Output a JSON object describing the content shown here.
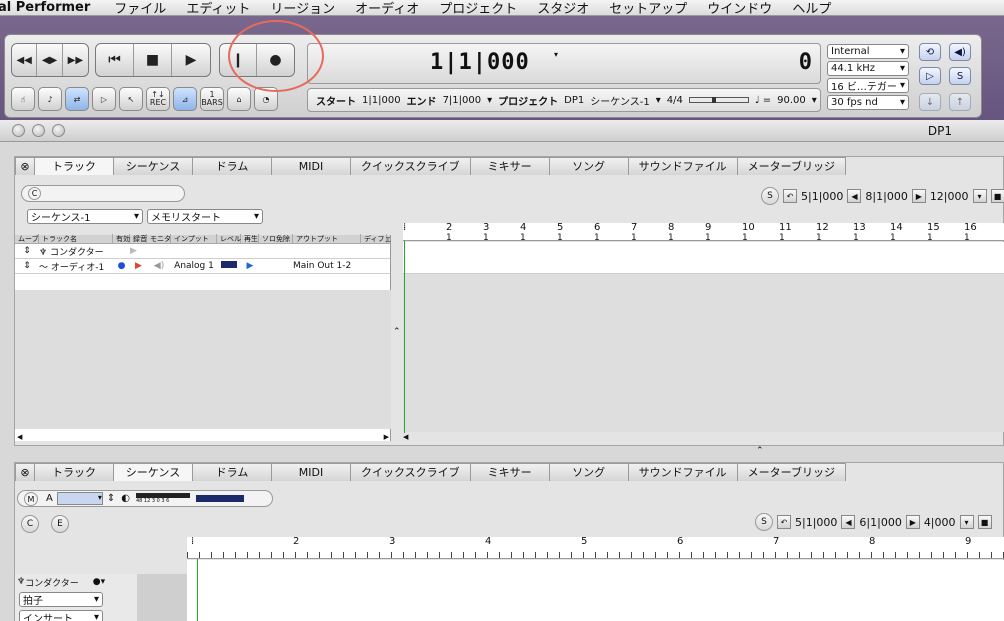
{
  "menubar": {
    "app": "al Performer",
    "items": [
      "ファイル",
      "エディット",
      "リージョン",
      "オーディオ",
      "プロジェクト",
      "スタジオ",
      "セットアップ",
      "ウインドウ",
      "ヘルプ"
    ]
  },
  "transport": {
    "counter_main": "1|1|000",
    "counter_right": "0",
    "info": {
      "start_label": "スタート",
      "start_value": "1|1|000",
      "end_label": "エンド",
      "end_value": "7|1|000",
      "project_label": "プロジェクト",
      "project_value": "DP1",
      "sequence": "シーケンス-1",
      "meter": "4/4",
      "tempo": "90.00"
    },
    "sync": "Internal",
    "rate": "44.1 kHz",
    "bits": "16 ビ…テガー",
    "fps": "30 fps nd",
    "tool_labels": {
      "rec": "REC",
      "bars": "BARS",
      "one": "1"
    }
  },
  "window": {
    "title": "DP1"
  },
  "tabs": [
    "トラック",
    "シーケンス",
    "ドラム",
    "MIDI",
    "クイックスクライブ",
    "ミキサー",
    "ソング",
    "サウンドファイル",
    "メーターブリッジ"
  ],
  "tracks_pane": {
    "sequence_select": "シーケンス-1",
    "memory_select": "メモリスタート",
    "nav": {
      "s": "S",
      "a": "5|1|000",
      "b": "8|1|000",
      "c": "12|000"
    },
    "columns": [
      "ムーブ",
      "トラック名",
      "有効",
      "録音",
      "モニタ",
      "インプット",
      "レベル",
      "再生",
      "ソロ免除",
      "アウトプット",
      "ディフェ"
    ],
    "rows": [
      {
        "name": "コンダクター",
        "input": "",
        "output": ""
      },
      {
        "name": "オーディオ-1",
        "input": "Analog 1",
        "output": "Main Out 1-2"
      }
    ],
    "ruler": [
      "2",
      "3",
      "4",
      "5",
      "6",
      "7",
      "8",
      "9",
      "10",
      "11",
      "12",
      "13",
      "14",
      "15",
      "16"
    ],
    "ruler_sub": "1"
  },
  "seq_pane": {
    "track_select": "A",
    "nav": {
      "s": "S",
      "a": "5|1|000",
      "b": "6|1|000",
      "c": "4|000"
    },
    "ruler": [
      "2",
      "3",
      "4",
      "5",
      "6",
      "7",
      "8",
      "9"
    ],
    "meter_scale": "48 12 3 0 3 6",
    "left_items": [
      {
        "label": "コンダクター"
      },
      {
        "label": "拍子"
      },
      {
        "label": "インサート"
      }
    ],
    "buttons": {
      "m": "M",
      "c": "C",
      "e": "E",
      "c2": "C"
    }
  }
}
